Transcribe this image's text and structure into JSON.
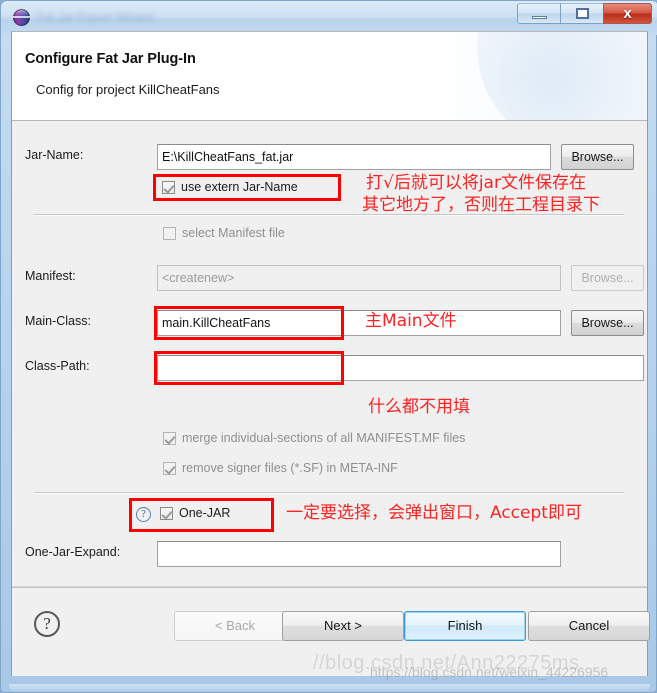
{
  "window": {
    "title_blurred": "Fat Jar Export Wizard",
    "icon": "eclipse-globe-icon",
    "controls": {
      "minimize": "minimize-icon",
      "maximize": "maximize-icon",
      "close": "x"
    }
  },
  "header": {
    "title": "Configure Fat Jar Plug-In",
    "subtitle": "Config for project KillCheatFans"
  },
  "form": {
    "jar_name": {
      "label": "Jar-Name:",
      "value": "E:\\KillCheatFans_fat.jar",
      "browse_label": "Browse..."
    },
    "use_extern": {
      "label": "use extern Jar-Name",
      "checked": true
    },
    "select_manifest": {
      "label": "select Manifest file",
      "checked": false
    },
    "manifest": {
      "label": "Manifest:",
      "value": "<createnew>",
      "browse_label": "Browse...",
      "disabled": true
    },
    "main_class": {
      "label": "Main-Class:",
      "value": "main.KillCheatFans",
      "browse_label": "Browse..."
    },
    "class_path": {
      "label": "Class-Path:",
      "value": ""
    },
    "merge_sections": {
      "label": "merge individual-sections of all MANIFEST.MF files",
      "checked": true
    },
    "remove_signer": {
      "label": "remove signer files (*.SF) in META-INF",
      "checked": true
    },
    "one_jar": {
      "label": "One-JAR",
      "checked": true,
      "help_glyph": "?"
    },
    "one_jar_expand": {
      "label": "One-Jar-Expand:",
      "value": ""
    }
  },
  "annotations": {
    "note_jar_name_line1": "打√后就可以将jar文件保存在",
    "note_jar_name_line2": "其它地方了，否则在工程目录下",
    "note_main_class": "主Main文件",
    "note_class_path": "什么都不用填",
    "note_one_jar": "一定要选择，会弹出窗口，Accept即可",
    "highlight_color": "#fe0000",
    "text_color": "#fe2222"
  },
  "buttons": {
    "help_glyph": "?",
    "back": "< Back",
    "next": "Next >",
    "finish": "Finish",
    "cancel": "Cancel"
  },
  "watermark": {
    "back": "//blog.csdn.net/Ann22275ms",
    "front": "https://blog.csdn.net/weixin_44226956"
  }
}
